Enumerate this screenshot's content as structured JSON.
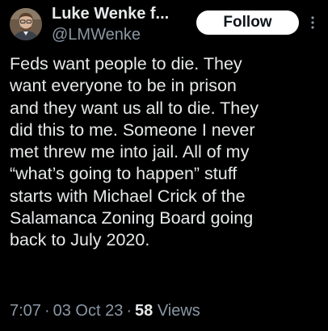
{
  "author": {
    "display_name": "Luke Wenke f...",
    "handle": "@LMWenke",
    "avatar_icon": "user-avatar-icon"
  },
  "header": {
    "follow_label": "Follow",
    "more_icon": "more-vertical-icon"
  },
  "tweet": {
    "lines": [
      "Feds want people to die.  They",
      "want everyone to be in prison",
      "and they want us all to die.  They",
      "did this to me.  Someone I never",
      "met threw me into jail.  All of my",
      "“what’s going to happen” stuff",
      "starts with Michael Crick of the",
      "Salamanca Zoning Board going",
      "back to July 2020."
    ]
  },
  "meta": {
    "time": "7:07",
    "separator": "·",
    "date": "03 Oct 23",
    "views_count": "58",
    "views_label": "Views"
  },
  "colors": {
    "background": "#000000",
    "text_primary": "#e7e9ea",
    "text_secondary": "#8b98a5",
    "follow_bg": "#ffffff",
    "follow_text": "#0f1419"
  }
}
